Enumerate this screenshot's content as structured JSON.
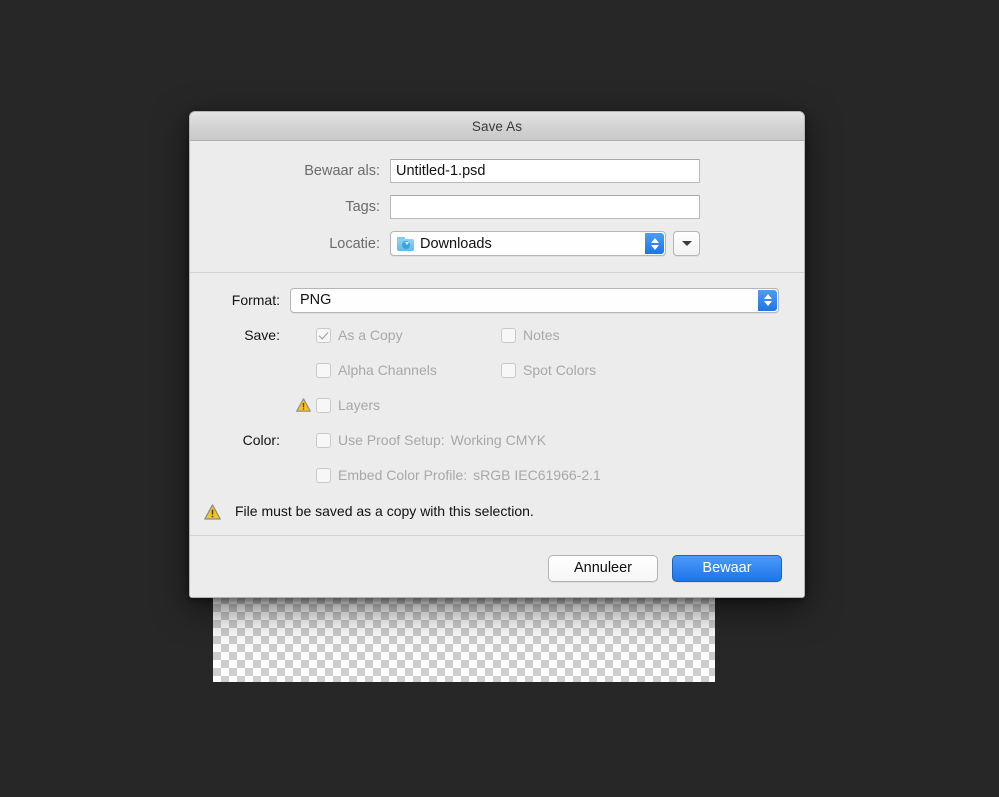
{
  "window": {
    "title": "Save As"
  },
  "canvas": {
    "name": "photoshop-transparency-canvas"
  },
  "top_section": {
    "rows": [
      {
        "label": "Bewaar als:",
        "value": "Untitled-1.psd",
        "placeholder": ""
      },
      {
        "label": "Tags:",
        "value": "",
        "placeholder": ""
      },
      {
        "label": "Locatie:",
        "value": "Downloads",
        "icon": "downloads-folder-icon"
      }
    ]
  },
  "format": {
    "label": "Format:",
    "value": "PNG",
    "icon": "stepper-updown-icon"
  },
  "save": {
    "label": "Save:",
    "options": [
      {
        "label": "As a Copy",
        "checked": true,
        "disabled": true
      },
      {
        "label": "Notes",
        "checked": false,
        "disabled": true
      },
      {
        "label": "Alpha Channels",
        "checked": false,
        "disabled": true
      },
      {
        "label": "Spot Colors",
        "checked": false,
        "disabled": true
      },
      {
        "label": "Layers",
        "checked": false,
        "disabled": true,
        "warning": true
      }
    ]
  },
  "color": {
    "label": "Color:",
    "options": [
      {
        "label": "Use Proof Setup:",
        "value": "Working CMYK",
        "checked": false,
        "disabled": true
      },
      {
        "label": "Embed Color Profile:",
        "value": "sRGB IEC61966-2.1",
        "checked": false,
        "disabled": true
      }
    ]
  },
  "warning": {
    "icon": "warning-triangle-icon",
    "message": "File must be saved as a copy with this selection."
  },
  "buttons": {
    "cancel_label": "Annuleer",
    "save_label": "Bewaar"
  },
  "colors": {
    "accent_blue": "#1f74e8",
    "warning_yellow": "#f5c518",
    "dialog_bg": "#ececec",
    "desktop_bg": "#272727",
    "disabled_text": "#a8a8a8"
  }
}
